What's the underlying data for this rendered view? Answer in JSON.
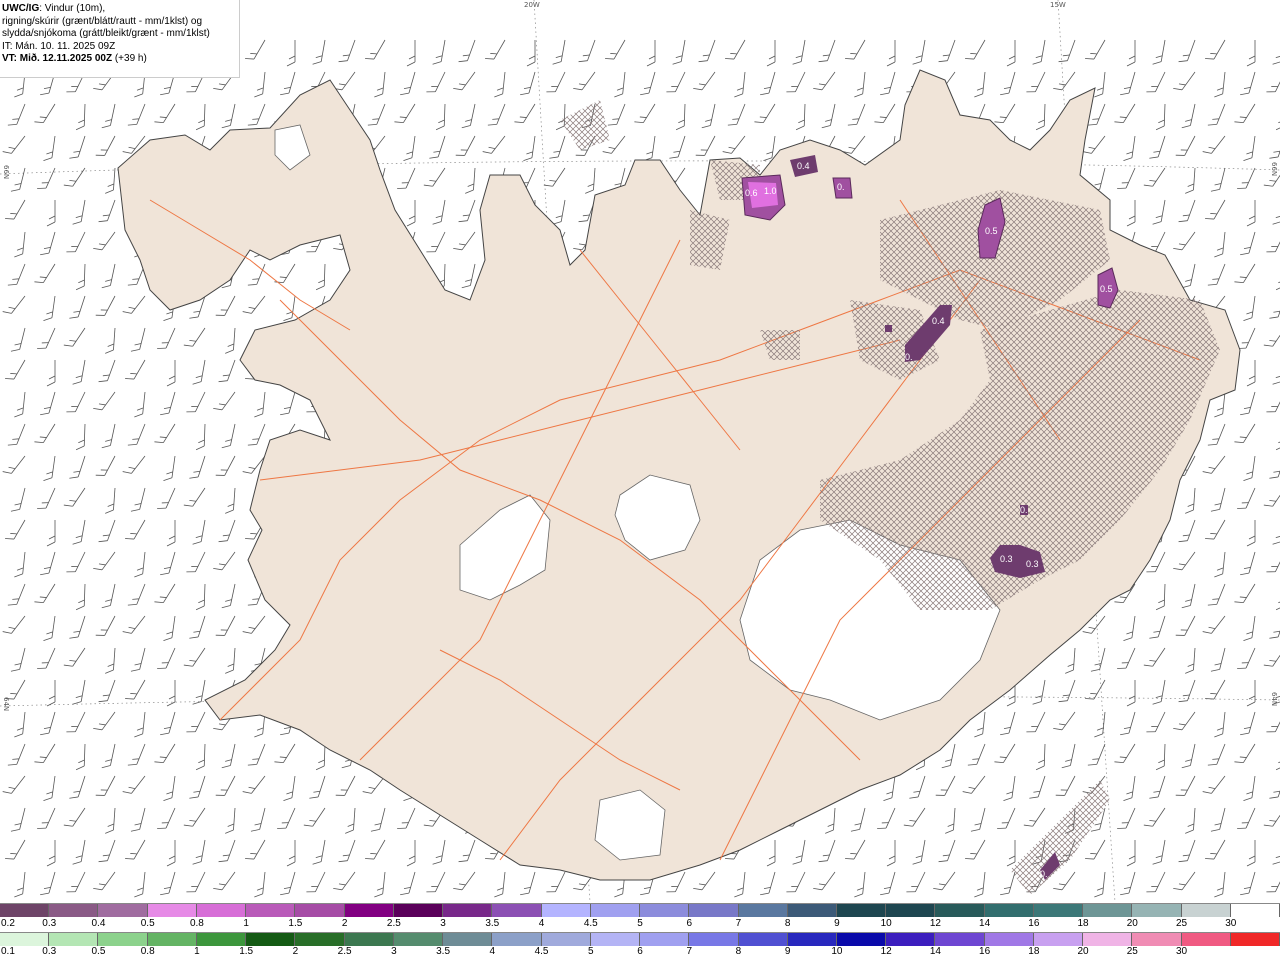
{
  "header": {
    "product": "UWC/IG",
    "line1": ": Vindur (10m),",
    "line2": "rigning/skúrir (grænt/blátt/rautt - mm/1klst) og",
    "line3": "slydda/snjókoma (grátt/bleikt/grænt - mm/1klst)",
    "it_label": "IT:",
    "it_value": "Mán. 10. 11. 2025 09Z",
    "vt_label": "VT: Mið. 12.11.2025 00Z",
    "vt_value": "(+39 h)"
  },
  "grid_labels": {
    "lon_20": "20W",
    "lon_15": "15W",
    "lat_66_left": "66N",
    "lat_66_right": "66N",
    "lat_64_left": "64N",
    "lat_64_right": "64N"
  },
  "precip_labels": [
    "0.6",
    "1.0",
    "0.4",
    "0.",
    "0.5",
    "0.4",
    "0.",
    "0.5",
    "0.",
    "0.3",
    "0.3",
    "0."
  ],
  "legend_snow": {
    "labels": [
      "0.2",
      "0.3",
      "0.4",
      "0.5",
      "0.8",
      "1",
      "1.5",
      "2",
      "2.5",
      "3",
      "3.5",
      "4",
      "4.5",
      "5",
      "6",
      "7",
      "8",
      "9",
      "10",
      "12",
      "14",
      "16",
      "18",
      "20",
      "25",
      "30"
    ],
    "colors": [
      "#6e4468",
      "#8a5a86",
      "#a06ca0",
      "#e68ae6",
      "#d76ed7",
      "#b95ab9",
      "#a64ca6",
      "#820082",
      "#5a005a",
      "#78288a",
      "#8c50b4",
      "#b4b4ff",
      "#a0a0f0",
      "#8c8cdc",
      "#7878c8",
      "#5a78a0",
      "#3c5a78",
      "#1e4650",
      "#1e4650",
      "#285a5a",
      "#326e6e",
      "#3c7878",
      "#6e9696",
      "#96b4b4",
      "#c8d2d2",
      "#ffffff"
    ]
  },
  "legend_rain": {
    "labels": [
      "0.1",
      "0.3",
      "0.5",
      "0.8",
      "1",
      "1.5",
      "2",
      "2.5",
      "3",
      "3.5",
      "4",
      "4.5",
      "5",
      "6",
      "7",
      "8",
      "9",
      "10",
      "12",
      "14",
      "16",
      "18",
      "20",
      "25",
      "30"
    ],
    "colors": [
      "#dcf5dc",
      "#b4e6b4",
      "#8cd28c",
      "#64b464",
      "#3c963c",
      "#145a14",
      "#286e28",
      "#3c7850",
      "#558c6e",
      "#6e8c96",
      "#8ca0c8",
      "#a0aadc",
      "#b4b4f5",
      "#a0a0f0",
      "#7878e6",
      "#5050d2",
      "#2828be",
      "#0a0aaa",
      "#3c1ebe",
      "#6e46d2",
      "#a078e6",
      "#c8a0f0",
      "#f0b4e6",
      "#f08cb4",
      "#f05a82",
      "#f02828"
    ]
  },
  "colors": {
    "land": "#f0e4d8",
    "coast": "#555555",
    "roads": "#ee7744",
    "glacier": "#ffffff",
    "precip_dark": "#6e3c6e",
    "precip_mid": "#a050a0",
    "precip_hot": "#e070e0"
  }
}
